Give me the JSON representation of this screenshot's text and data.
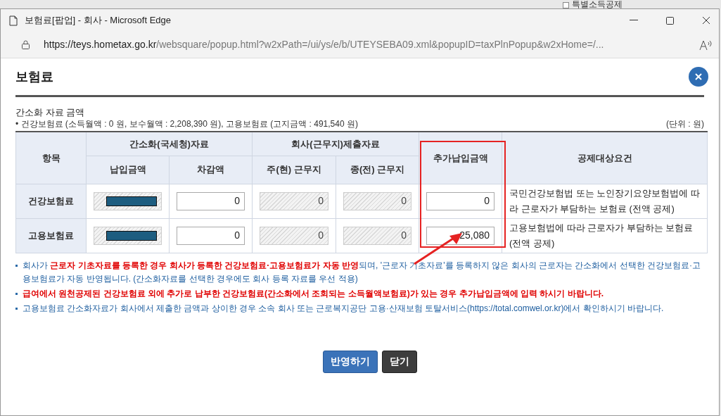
{
  "background_page": {
    "section_label": "특별소득공제"
  },
  "window": {
    "title": "보험료[팝업] - 회사 - Microsoft Edge",
    "url_host": "https://teys.hometax.go.kr",
    "url_path": "/websquare/popup.html?w2xPath=/ui/ys/e/b/UTEYSEBA09.xml&popupID=taxPlnPopup&w2xHome=/..."
  },
  "dialog": {
    "title": "보험료",
    "section_title": "간소화 자료 금액",
    "summary": "• 건강보험료 (소득월액 : 0 원, 보수월액 : 2,208,390 원), 고용보험료 (고지금액 : 491,540 원)",
    "unit": "(단위 : 원)"
  },
  "table": {
    "header_groups": [
      {
        "label": "항목"
      },
      {
        "label": "간소화(국세청)자료",
        "subheaders": [
          "납입금액",
          "차감액"
        ]
      },
      {
        "label": "회사(근무지)제출자료",
        "subheaders": [
          "주(현) 근무지",
          "종(전) 근무지"
        ]
      },
      {
        "label": "추가납입금액",
        "highlighted": true
      },
      {
        "label": "공제대상요건"
      }
    ],
    "rows": [
      {
        "label": "건강보험료",
        "cells": [
          {
            "kind": "masked"
          },
          {
            "kind": "input",
            "value": "0"
          },
          {
            "kind": "readonly",
            "value": "0"
          },
          {
            "kind": "readonly",
            "value": "0"
          },
          {
            "kind": "input",
            "value": "0"
          }
        ],
        "requirement": "국민건강보험법 또는 노인장기요양보험법에 따라 근로자가 부담하는 보험료 (전액 공제)"
      },
      {
        "label": "고용보험료",
        "cells": [
          {
            "kind": "masked"
          },
          {
            "kind": "input",
            "value": "0"
          },
          {
            "kind": "readonly",
            "value": "0"
          },
          {
            "kind": "readonly",
            "value": "0"
          },
          {
            "kind": "input",
            "value": "25,080",
            "annotated": true
          }
        ],
        "requirement": "고용보험법에 따라 근로자가 부담하는 보험료 (전액 공제)"
      }
    ]
  },
  "notes": [
    {
      "segments": [
        {
          "text": "회사가 ",
          "emphasis": false
        },
        {
          "text": "근로자 기초자료를 등록한 경우 회사가 등록한 건강보험료·고용보험료가 자동 반영",
          "emphasis": true
        },
        {
          "text": "되며, '근로자 기초자료'를 등록하지 않은 회사의 근로자는 간소화에서 선택한 건강보험료·고용보험료가 자동 반영됩니다. (간소화자료를 선택한 경우에도 회사 등록 자료를 우선 적용)",
          "emphasis": false
        }
      ]
    },
    {
      "segments": [
        {
          "text": "급여에서 원천공제된 건강보험료 외에 추가로 납부한 건강보험료(간소화에서 조회되는 소득월액보험료)가 있는 경우 추가납입금액에 입력 하시기 바랍니다.",
          "emphasis": true
        }
      ]
    },
    {
      "segments": [
        {
          "text": "고용보험료 간소화자료가 회사에서 제출한 금액과 상이한 경우 소속 회사 또는 근로복지공단 고용·산재보험 토탈서비스(https://total.comwel.or.kr)에서 확인하시기 바랍니다.",
          "emphasis": false
        }
      ]
    }
  ],
  "buttons": [
    {
      "label": "반영하기",
      "kind": "primary"
    },
    {
      "label": "닫기",
      "kind": "dark"
    }
  ]
}
